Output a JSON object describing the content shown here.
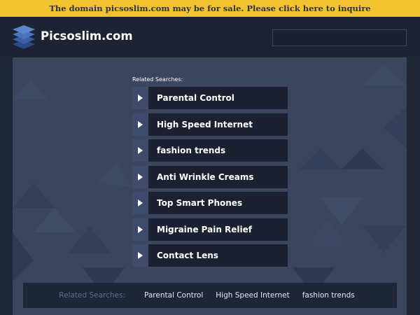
{
  "topbar": {
    "notice": "The domain picsoslim.com may be for sale. Please click here to inquire"
  },
  "header": {
    "logo_icon": "stacked-layers-icon",
    "brand": "Picsoslim.com",
    "search_value": ""
  },
  "main": {
    "related_label": "Related Searches:",
    "items": [
      {
        "label": "Parental Control"
      },
      {
        "label": "High Speed Internet"
      },
      {
        "label": "fashion trends"
      },
      {
        "label": "Anti Wrinkle Creams"
      },
      {
        "label": "Top Smart Phones"
      },
      {
        "label": "Migraine Pain Relief"
      },
      {
        "label": "Contact Lens"
      }
    ]
  },
  "footer": {
    "label": "Related Searches:",
    "links": [
      "Parental Control",
      "High Speed Internet",
      "fashion trends"
    ]
  },
  "colors": {
    "topbar_bg": "#f2c230",
    "page_bg": "#1f2636",
    "panel_bg": "#39465e",
    "item_bg": "#1b2131",
    "arrow_bg": "#3e4b6a"
  }
}
